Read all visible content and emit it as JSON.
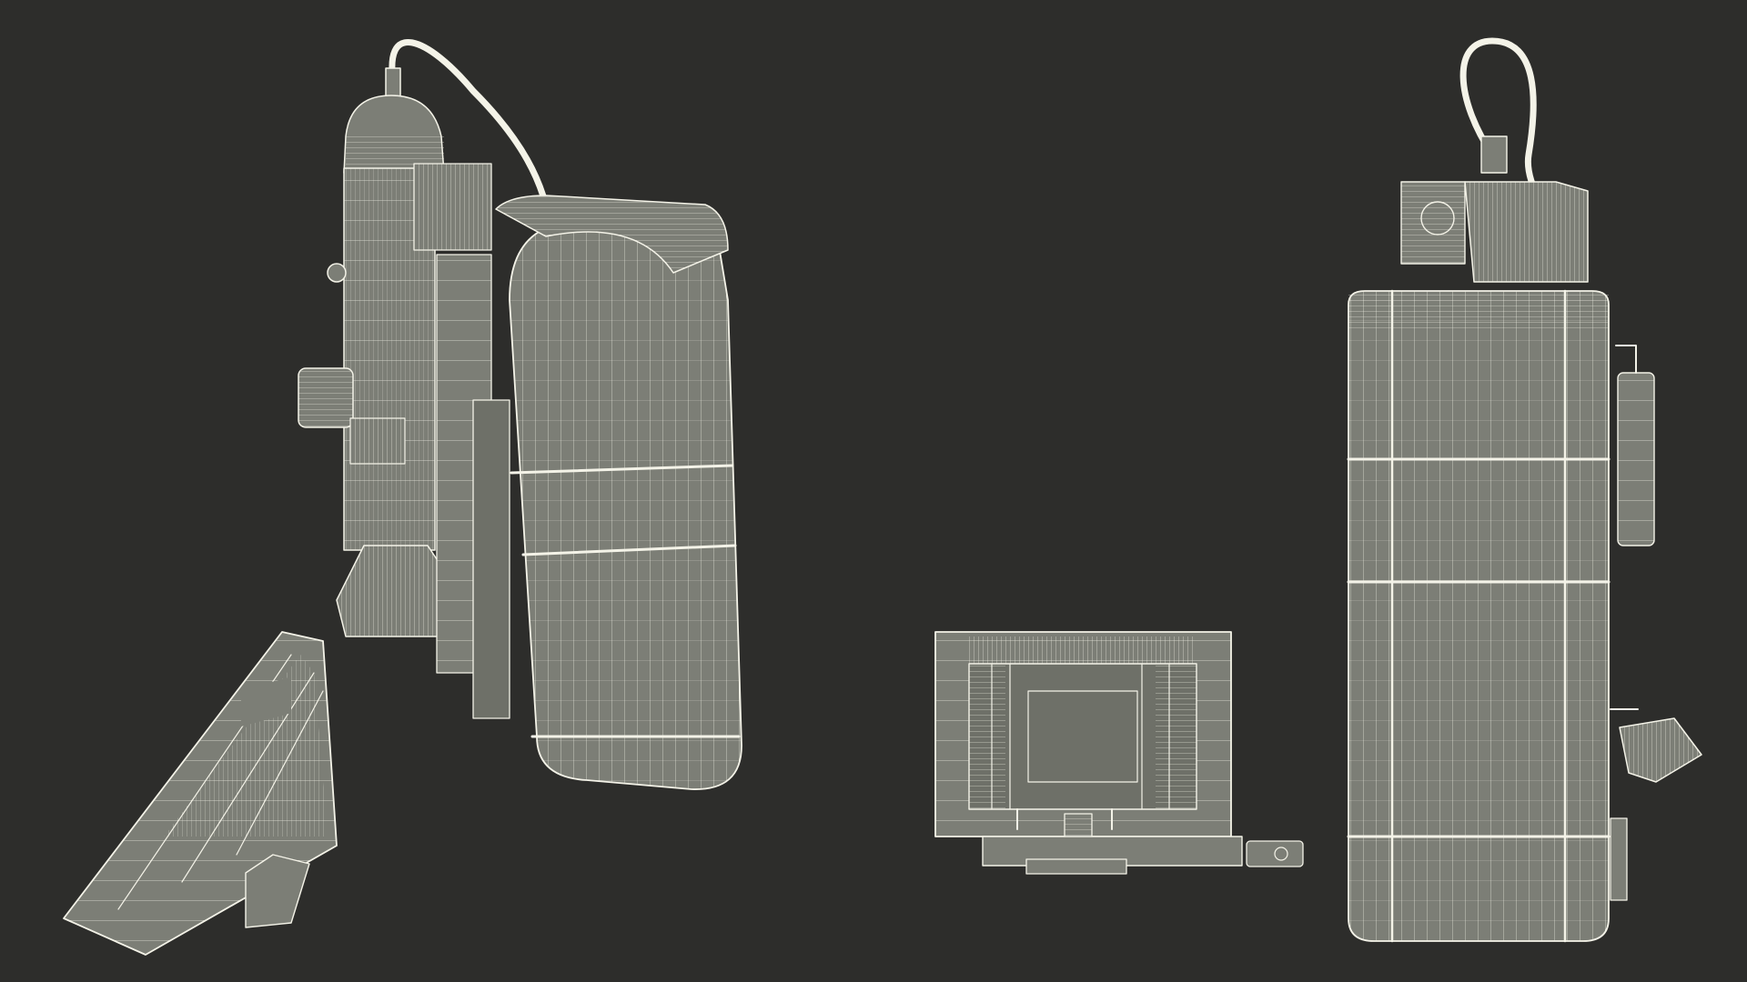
{
  "scene": {
    "background_color": "#2d2d2b",
    "wire_color": "#f4f3e8",
    "surface_color": "#7c7e76",
    "objects": [
      {
        "name": "microscope-perspective-view",
        "icon": "wireframe-microscope"
      },
      {
        "name": "monitor-perspective-view",
        "icon": "wireframe-monitor"
      },
      {
        "name": "monitor-back-view",
        "icon": "wireframe-monitor"
      },
      {
        "name": "microscope-back-view",
        "icon": "wireframe-microscope"
      }
    ]
  }
}
